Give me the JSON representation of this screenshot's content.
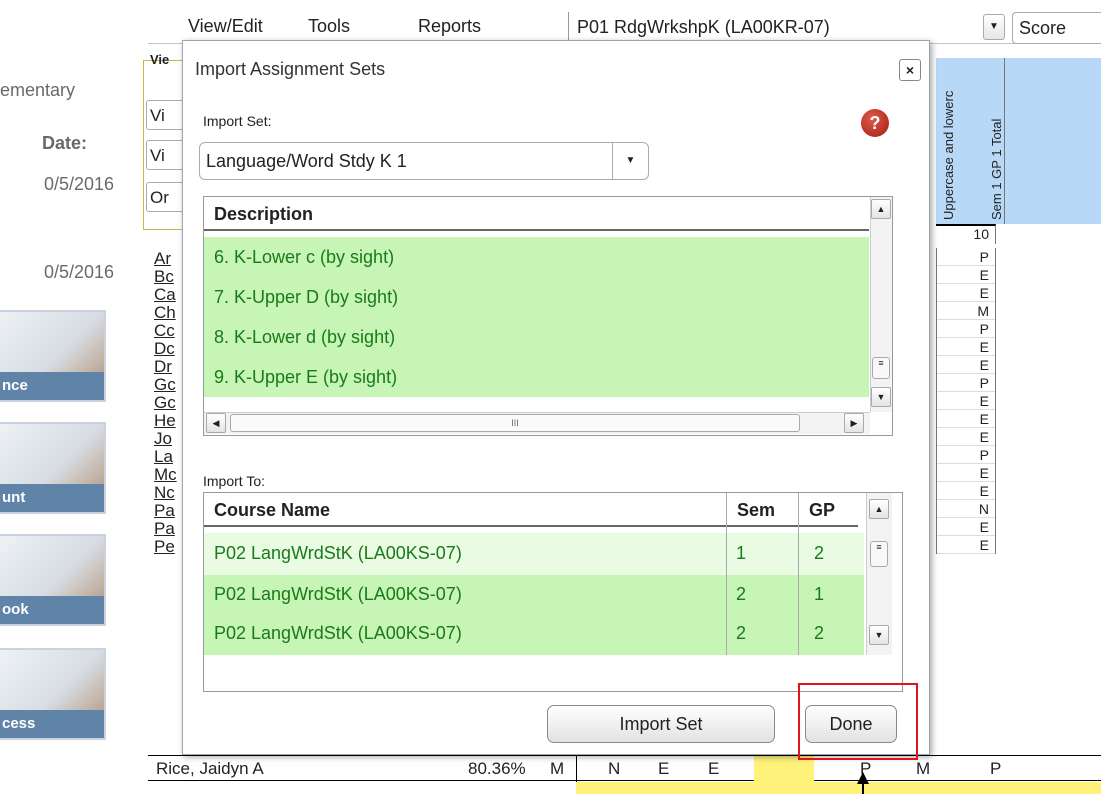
{
  "sidebar": {
    "school_fragment": "ementary",
    "date_label": "Date:",
    "date1": "0/5/2016",
    "date2": "0/5/2016",
    "tiles": [
      {
        "label": "nce"
      },
      {
        "label": "unt"
      },
      {
        "label": "ook"
      },
      {
        "label": "cess"
      }
    ]
  },
  "menubar": {
    "items": [
      "View/Edit",
      "Tools",
      "Reports"
    ],
    "course": "P01   RdgWrkshpK (LA00KR-07)",
    "score_label": "Score"
  },
  "background": {
    "filter_buttons": [
      "Vi",
      "Vi",
      "Or"
    ],
    "tab_label": "Vie",
    "student_names": [
      "Ar",
      "Bc",
      "Ca",
      "Ch",
      "Cc",
      "Dc",
      "Dr",
      "Gc",
      "Gc",
      "He",
      "Jo",
      "La",
      "Mc",
      "Nc",
      "Pa",
      "Pa",
      "Pe"
    ],
    "col_header_1": "Uppercase and lowerc",
    "col_header_2": "Sem 1 GP 1 Total",
    "col_number": "10",
    "grades": [
      "P",
      "E",
      "E",
      "M",
      "P",
      "E",
      "E",
      "P",
      "E",
      "E",
      "E",
      "P",
      "E",
      "E",
      "N",
      "E",
      "E"
    ],
    "bottom_row": {
      "name": "Rice, Jaidyn A",
      "percent": "80.36%",
      "mark": "M",
      "scores": [
        "N",
        "E",
        "E",
        "",
        "P",
        "M",
        "P"
      ]
    }
  },
  "dialog": {
    "title": "Import Assignment Sets",
    "close_label": "×",
    "import_set_label": "Import Set:",
    "import_set_value": "Language/Word Stdy K 1",
    "description_header": "Description",
    "descriptions": [
      "6. K-Lower c (by sight)",
      "7. K-Upper D (by sight)",
      "8. K-Lower d (by sight)",
      "9. K-Upper E (by sight)"
    ],
    "hscroll_mark": "III",
    "import_to_label": "Import To:",
    "columns": {
      "course": "Course Name",
      "sem": "Sem",
      "gp": "GP"
    },
    "courses": [
      {
        "name": "P02   LangWrdStK (LA00KS-07)",
        "sem": "1",
        "gp": "2"
      },
      {
        "name": "P02   LangWrdStK (LA00KS-07)",
        "sem": "2",
        "gp": "1"
      },
      {
        "name": "P02   LangWrdStK (LA00KS-07)",
        "sem": "2",
        "gp": "2"
      }
    ],
    "import_button": "Import Set",
    "done_button": "Done"
  },
  "colors": {
    "row_green": "#c6f5b6",
    "text_green": "#1a7a1a",
    "header_blue": "#b7d9f7",
    "highlight_red": "#e0141b",
    "sidebar_label_bg": "#5f84a8"
  }
}
